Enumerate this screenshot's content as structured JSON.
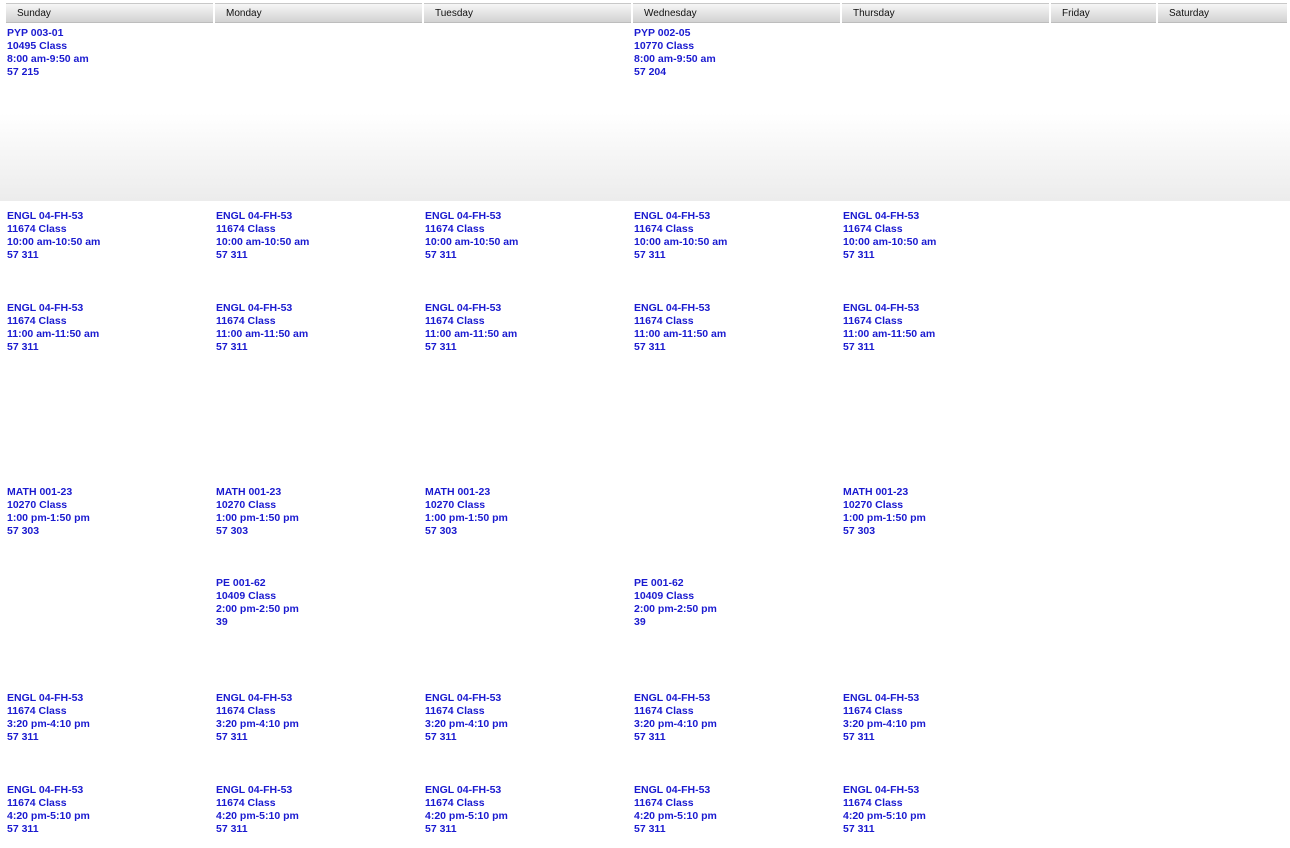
{
  "days": [
    {
      "id": "sunday",
      "label": "Sunday",
      "events": [
        {
          "course": "PYP 003-01",
          "class_no": "10495 Class",
          "time": "8:00 am-9:50 am",
          "room": "57 215"
        },
        {
          "course": "ENGL 04-FH-53",
          "class_no": "11674 Class",
          "time": "10:00 am-10:50 am",
          "room": "57 311"
        },
        {
          "course": "ENGL 04-FH-53",
          "class_no": "11674 Class",
          "time": "11:00 am-11:50 am",
          "room": "57 311"
        },
        {
          "course": "MATH 001-23",
          "class_no": "10270 Class",
          "time": "1:00 pm-1:50 pm",
          "room": "57 303"
        },
        {
          "course": "ENGL 04-FH-53",
          "class_no": "11674 Class",
          "time": "3:20 pm-4:10 pm",
          "room": "57 311"
        },
        {
          "course": "ENGL 04-FH-53",
          "class_no": "11674 Class",
          "time": "4:20 pm-5:10 pm",
          "room": "57 311"
        }
      ]
    },
    {
      "id": "monday",
      "label": "Monday",
      "events": [
        {
          "course": "ENGL 04-FH-53",
          "class_no": "11674 Class",
          "time": "10:00 am-10:50 am",
          "room": "57 311"
        },
        {
          "course": "ENGL 04-FH-53",
          "class_no": "11674 Class",
          "time": "11:00 am-11:50 am",
          "room": "57 311"
        },
        {
          "course": "MATH 001-23",
          "class_no": "10270 Class",
          "time": "1:00 pm-1:50 pm",
          "room": "57 303"
        },
        {
          "course": "PE 001-62",
          "class_no": "10409 Class",
          "time": "2:00 pm-2:50 pm",
          "room": "39"
        },
        {
          "course": "ENGL 04-FH-53",
          "class_no": "11674 Class",
          "time": "3:20 pm-4:10 pm",
          "room": "57 311"
        },
        {
          "course": "ENGL 04-FH-53",
          "class_no": "11674 Class",
          "time": "4:20 pm-5:10 pm",
          "room": "57 311"
        }
      ]
    },
    {
      "id": "tuesday",
      "label": "Tuesday",
      "events": [
        {
          "course": "ENGL 04-FH-53",
          "class_no": "11674 Class",
          "time": "10:00 am-10:50 am",
          "room": "57 311"
        },
        {
          "course": "ENGL 04-FH-53",
          "class_no": "11674 Class",
          "time": "11:00 am-11:50 am",
          "room": "57 311"
        },
        {
          "course": "MATH 001-23",
          "class_no": "10270 Class",
          "time": "1:00 pm-1:50 pm",
          "room": "57 303"
        },
        {
          "course": "ENGL 04-FH-53",
          "class_no": "11674 Class",
          "time": "3:20 pm-4:10 pm",
          "room": "57 311"
        },
        {
          "course": "ENGL 04-FH-53",
          "class_no": "11674 Class",
          "time": "4:20 pm-5:10 pm",
          "room": "57 311"
        }
      ]
    },
    {
      "id": "wednesday",
      "label": "Wednesday",
      "events": [
        {
          "course": "PYP 002-05",
          "class_no": "10770 Class",
          "time": "8:00 am-9:50 am",
          "room": "57 204"
        },
        {
          "course": "ENGL 04-FH-53",
          "class_no": "11674 Class",
          "time": "10:00 am-10:50 am",
          "room": "57 311"
        },
        {
          "course": "ENGL 04-FH-53",
          "class_no": "11674 Class",
          "time": "11:00 am-11:50 am",
          "room": "57 311"
        },
        {
          "course": "PE 001-62",
          "class_no": "10409 Class",
          "time": "2:00 pm-2:50 pm",
          "room": "39"
        },
        {
          "course": "ENGL 04-FH-53",
          "class_no": "11674 Class",
          "time": "3:20 pm-4:10 pm",
          "room": "57 311"
        },
        {
          "course": "ENGL 04-FH-53",
          "class_no": "11674 Class",
          "time": "4:20 pm-5:10 pm",
          "room": "57 311"
        }
      ]
    },
    {
      "id": "thursday",
      "label": "Thursday",
      "events": [
        {
          "course": "ENGL 04-FH-53",
          "class_no": "11674 Class",
          "time": "10:00 am-10:50 am",
          "room": "57 311"
        },
        {
          "course": "ENGL 04-FH-53",
          "class_no": "11674 Class",
          "time": "11:00 am-11:50 am",
          "room": "57 311"
        },
        {
          "course": "MATH 001-23",
          "class_no": "10270 Class",
          "time": "1:00 pm-1:50 pm",
          "room": "57 303"
        },
        {
          "course": "ENGL 04-FH-53",
          "class_no": "11674 Class",
          "time": "3:20 pm-4:10 pm",
          "room": "57 311"
        },
        {
          "course": "ENGL 04-FH-53",
          "class_no": "11674 Class",
          "time": "4:20 pm-5:10 pm",
          "room": "57 311"
        }
      ]
    },
    {
      "id": "friday",
      "label": "Friday",
      "events": []
    },
    {
      "id": "saturday",
      "label": "Saturday",
      "events": []
    }
  ],
  "colors": {
    "event_text": "#1a1ad0",
    "header_text": "#111111"
  }
}
